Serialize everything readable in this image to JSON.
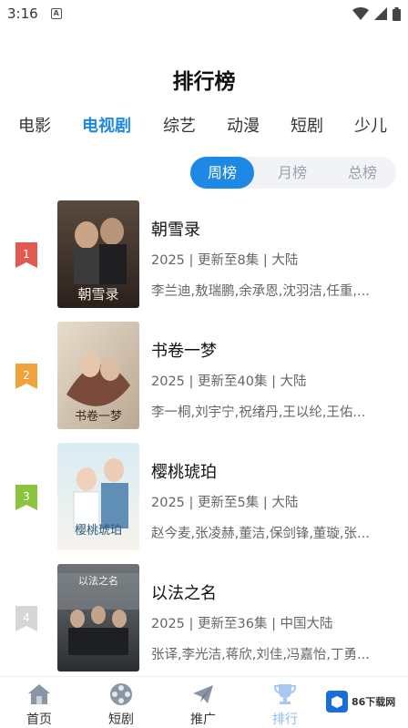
{
  "status_bar": {
    "time": "3:16",
    "notification_label": "A"
  },
  "page": {
    "title": "排行榜"
  },
  "category_tabs": [
    {
      "label": "电影",
      "active": false
    },
    {
      "label": "电视剧",
      "active": true
    },
    {
      "label": "综艺",
      "active": false
    },
    {
      "label": "动漫",
      "active": false
    },
    {
      "label": "短剧",
      "active": false
    },
    {
      "label": "少儿",
      "active": false
    }
  ],
  "period_tabs": [
    {
      "label": "周榜",
      "active": true
    },
    {
      "label": "月榜",
      "active": false
    },
    {
      "label": "总榜",
      "active": false
    }
  ],
  "ranking": [
    {
      "rank": "1",
      "badge_color": "#e25a4f",
      "title": "朝雪录",
      "meta": "2025 | 更新至8集 | 大陆",
      "cast": "李兰迪,敖瑞鹏,余承恩,沈羽洁,任重,...",
      "poster_text": "朝雪录"
    },
    {
      "rank": "2",
      "badge_color": "#f0a23b",
      "title": "书卷一梦",
      "meta": "2025 | 更新至40集 | 大陆",
      "cast": "李一桐,刘宇宁,祝绪丹,王以纶,王佑...",
      "poster_text": "书卷一梦"
    },
    {
      "rank": "3",
      "badge_color": "#8cc43f",
      "title": "樱桃琥珀",
      "meta": "2025 | 更新至5集 | 大陆",
      "cast": "赵今麦,张凌赫,董洁,保剑锋,董璇,张...",
      "poster_text": "樱桃琥珀"
    },
    {
      "rank": "4",
      "badge_color": "#d6d6d6",
      "title": "以法之名",
      "meta": "2025 | 更新至36集 | 中国大陆",
      "cast": "张译,李光洁,蒋欣,刘佳,冯嘉怡,丁勇...",
      "poster_text": "以法之名"
    }
  ],
  "bottom_nav": [
    {
      "label": "首页",
      "icon": "home-icon",
      "active": false
    },
    {
      "label": "短剧",
      "icon": "film-reel-icon",
      "active": false
    },
    {
      "label": "推广",
      "icon": "paper-plane-icon",
      "active": false
    },
    {
      "label": "排行",
      "icon": "trophy-icon",
      "active": true
    }
  ],
  "watermark": {
    "text": "86下载网"
  },
  "colors": {
    "accent": "#1e88e5",
    "inactive_tab_bg": "#f1f3f6"
  }
}
